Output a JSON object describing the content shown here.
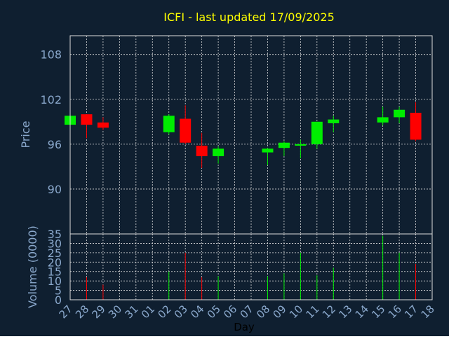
{
  "colors": {
    "background": "#0f1f30",
    "grid": "#dddddd",
    "axis": "#dddddd",
    "text": "#8aa8cc",
    "title": "#ffff00",
    "up": "#00ee00",
    "down": "#ff0000"
  },
  "chart_data": [
    {
      "type": "candlestick",
      "title": "ICFI - last updated 17/09/2025",
      "xlabel": "",
      "ylabel": "Price",
      "ylim": [
        84,
        110.5
      ],
      "y_ticks": [
        90,
        96,
        102,
        108
      ],
      "grid": true,
      "categories": [
        "27",
        "28",
        "29",
        "30",
        "31",
        "01",
        "02",
        "03",
        "04",
        "05",
        "06",
        "07",
        "08",
        "09",
        "10",
        "11",
        "12",
        "13",
        "14",
        "15",
        "16",
        "17",
        "18"
      ],
      "candles": [
        {
          "day": "27",
          "open": 98.6,
          "high": 99.8,
          "low": 98.6,
          "close": 99.8
        },
        {
          "day": "28",
          "open": 100.0,
          "high": 100.0,
          "low": 96.8,
          "close": 98.6
        },
        {
          "day": "29",
          "open": 98.9,
          "high": 99.6,
          "low": 97.9,
          "close": 98.2
        },
        {
          "day": "02",
          "open": 97.6,
          "high": 100.0,
          "low": 97.3,
          "close": 99.8
        },
        {
          "day": "03",
          "open": 99.4,
          "high": 101.2,
          "low": 96.0,
          "close": 96.2
        },
        {
          "day": "04",
          "open": 95.8,
          "high": 97.5,
          "low": 92.8,
          "close": 94.4
        },
        {
          "day": "05",
          "open": 94.4,
          "high": 95.7,
          "low": 93.4,
          "close": 95.4
        },
        {
          "day": "08",
          "open": 94.9,
          "high": 95.5,
          "low": 93.2,
          "close": 95.4
        },
        {
          "day": "09",
          "open": 95.5,
          "high": 96.4,
          "low": 94.4,
          "close": 96.2
        },
        {
          "day": "10",
          "open": 95.8,
          "high": 96.6,
          "low": 94.1,
          "close": 96.0
        },
        {
          "day": "11",
          "open": 96.0,
          "high": 99.0,
          "low": 95.4,
          "close": 99.0
        },
        {
          "day": "12",
          "open": 98.8,
          "high": 99.8,
          "low": 97.6,
          "close": 99.3
        },
        {
          "day": "15",
          "open": 98.9,
          "high": 101.0,
          "low": 98.5,
          "close": 99.6
        },
        {
          "day": "16",
          "open": 99.6,
          "high": 101.0,
          "low": 98.8,
          "close": 100.6
        },
        {
          "day": "17",
          "open": 100.2,
          "high": 101.6,
          "low": 96.4,
          "close": 96.6
        }
      ]
    },
    {
      "type": "bar",
      "title": "",
      "xlabel": "Day",
      "ylabel": "Volume (0000)",
      "ylim": [
        0,
        35
      ],
      "y_ticks": [
        0,
        5,
        10,
        15,
        20,
        25,
        30,
        35
      ],
      "grid": true,
      "categories": [
        "27",
        "28",
        "29",
        "30",
        "31",
        "01",
        "02",
        "03",
        "04",
        "05",
        "06",
        "07",
        "08",
        "09",
        "10",
        "11",
        "12",
        "13",
        "14",
        "15",
        "16",
        "17",
        "18"
      ],
      "bars": [
        {
          "day": "28",
          "value": 12,
          "direction": "down"
        },
        {
          "day": "29",
          "value": 8,
          "direction": "down"
        },
        {
          "day": "02",
          "value": 15,
          "direction": "up"
        },
        {
          "day": "03",
          "value": 25,
          "direction": "down"
        },
        {
          "day": "04",
          "value": 12,
          "direction": "down"
        },
        {
          "day": "05",
          "value": 12.5,
          "direction": "up"
        },
        {
          "day": "08",
          "value": 12.5,
          "direction": "up"
        },
        {
          "day": "09",
          "value": 14,
          "direction": "up"
        },
        {
          "day": "10",
          "value": 25,
          "direction": "up"
        },
        {
          "day": "11",
          "value": 13,
          "direction": "up"
        },
        {
          "day": "12",
          "value": 17,
          "direction": "up"
        },
        {
          "day": "15",
          "value": 34,
          "direction": "up"
        },
        {
          "day": "16",
          "value": 25,
          "direction": "up"
        },
        {
          "day": "17",
          "value": 19,
          "direction": "down"
        }
      ]
    }
  ]
}
